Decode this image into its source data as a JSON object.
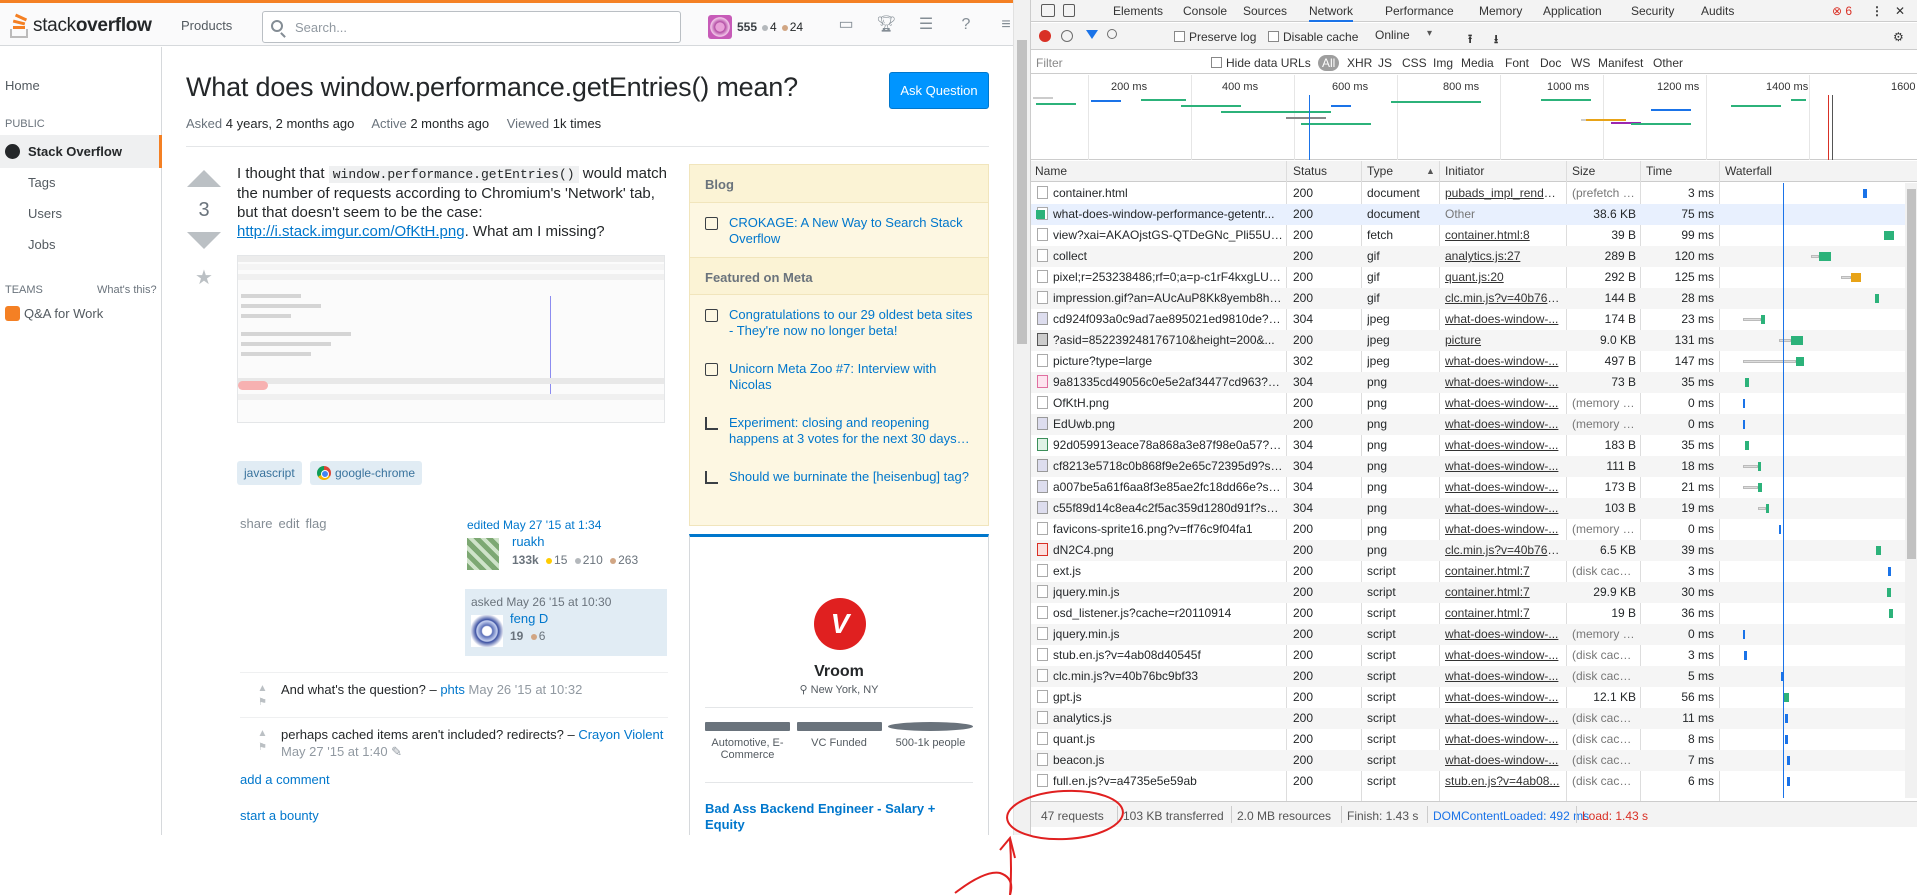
{
  "so": {
    "logo": {
      "stack": "stack",
      "overflow": "overflow"
    },
    "products": "Products",
    "search_placeholder": "Search...",
    "user": {
      "rep": "555",
      "silver": "4",
      "bronze": "24"
    },
    "nav": {
      "home": "Home",
      "public": "PUBLIC",
      "stack_overflow": "Stack Overflow",
      "tags": "Tags",
      "users": "Users",
      "jobs": "Jobs",
      "teams": "TEAMS",
      "whats_this": "What's this?",
      "qa_for_work": "Q&A for Work"
    },
    "question": {
      "title": "What does window.performance.getEntries() mean?",
      "ask_button": "Ask Question",
      "asked_label": "Asked",
      "asked_value": "4 years, 2 months ago",
      "active_label": "Active",
      "active_value": "2 months ago",
      "viewed_label": "Viewed",
      "viewed_value": "1k times",
      "votes": "3",
      "body_1": "I thought that ",
      "body_code": "window.performance.getEntries()",
      "body_2": " would match the number of requests according to Chromium's 'Network' tab, but that doesn't seem to be the case: ",
      "body_link": "http://i.stack.imgur.com/OfKtH.png",
      "body_3": ". What am I missing?",
      "tags": [
        "javascript",
        "google-chrome"
      ],
      "menu": [
        "share",
        "edit",
        "flag"
      ],
      "edited": {
        "when": "edited May 27 '15 at 1:34",
        "name": "ruakh",
        "rep": "133k",
        "gold": "15",
        "silver": "210",
        "bronze": "263"
      },
      "asked": {
        "when": "asked May 26 '15 at 10:30",
        "name": "feng D",
        "rep": "19",
        "bronze": "6"
      }
    },
    "comments": [
      {
        "text": "And what's the question? – ",
        "user": "phts",
        "date": " May 26 '15 at 10:32"
      },
      {
        "text": "perhaps cached items aren't included? redirects? – ",
        "user": "Crayon Violent",
        "date": " May 27 '15 at 1:40 ✎"
      }
    ],
    "add_comment": "add a comment",
    "start_bounty": "start a bounty",
    "sidebar": {
      "blog_heading": "Blog",
      "blog_items": [
        "CROKAGE: A New Way to Search Stack Overflow"
      ],
      "meta_heading": "Featured on Meta",
      "meta_items": [
        "Congratulations to our 29 oldest beta sites - They're now no longer beta!",
        "Unicorn Meta Zoo #7: Interview with Nicolas",
        "Experiment: closing and reopening happens at 3 votes for the next 30 days…",
        "Should we burninate the [heisenbug] tag?"
      ]
    },
    "job": {
      "logo_letter": "V",
      "company": "Vroom",
      "location": "New York, NY",
      "facts": [
        "Automotive, E-Commerce",
        "VC Funded",
        "500-1k people"
      ],
      "title": "Bad Ass Backend Engineer - Salary + Equity"
    }
  },
  "devtools": {
    "tabs": [
      "Elements",
      "Console",
      "Sources",
      "Network",
      "Performance",
      "Memory",
      "Application",
      "Security",
      "Audits"
    ],
    "active_tab": "Network",
    "error_count": "6",
    "toolbar": {
      "preserve_log": "Preserve log",
      "disable_cache": "Disable cache",
      "throttle": "Online"
    },
    "filter_placeholder": "Filter",
    "hide_data_urls": "Hide data URLs",
    "types": [
      "All",
      "XHR",
      "JS",
      "CSS",
      "Img",
      "Media",
      "Font",
      "Doc",
      "WS",
      "Manifest",
      "Other"
    ],
    "overview_ticks": [
      "200 ms",
      "400 ms",
      "600 ms",
      "800 ms",
      "1000 ms",
      "1200 ms",
      "1400 ms",
      "1600"
    ],
    "columns": [
      "Name",
      "Status",
      "Type",
      "Initiator",
      "Size",
      "Time",
      "Waterfall"
    ],
    "requests": [
      {
        "name": "container.html",
        "status": "200",
        "type": "document",
        "initiator": "pubads_impl_render...",
        "size": "(prefetch c...",
        "time": "3 ms",
        "icon": "doc"
      },
      {
        "name": "what-does-window-performance-getentr...",
        "status": "200",
        "type": "document",
        "initiator": "Other",
        "size": "38.6 KB",
        "time": "75 ms",
        "icon": "doc"
      },
      {
        "name": "view?xai=AKAOjstGS-QTDeGNc_Pli55UR...",
        "status": "200",
        "type": "fetch",
        "initiator": "container.html:8",
        "size": "39 B",
        "time": "99 ms",
        "icon": "doc"
      },
      {
        "name": "collect",
        "status": "200",
        "type": "gif",
        "initiator": "analytics.js:27",
        "size": "289 B",
        "time": "120 ms",
        "icon": "doc"
      },
      {
        "name": "pixel;r=253238486;rf=0;a=p-c1rF4kxgLUz...",
        "status": "200",
        "type": "gif",
        "initiator": "quant.js:20",
        "size": "292 B",
        "time": "125 ms",
        "icon": "doc"
      },
      {
        "name": "impression.gif?an=AUcAuP8Kk8yemb8h1...",
        "status": "200",
        "type": "gif",
        "initiator": "clc.min.js?v=40b76b...",
        "size": "144 B",
        "time": "28 ms",
        "icon": "doc"
      },
      {
        "name": "cd924f093a0c9ad7ae895021ed9810de?s...",
        "status": "304",
        "type": "jpeg",
        "initiator": "what-does-window-...",
        "size": "174 B",
        "time": "23 ms",
        "icon": "img"
      },
      {
        "name": "?asid=852239248176710&height=200&...",
        "status": "200",
        "type": "jpeg",
        "initiator": "picture",
        "size": "9.0 KB",
        "time": "131 ms",
        "icon": "dark"
      },
      {
        "name": "picture?type=large",
        "status": "302",
        "type": "jpeg",
        "initiator": "what-does-window-...",
        "size": "497 B",
        "time": "147 ms",
        "icon": "doc"
      },
      {
        "name": "9a81335cd49056c0e5e2af34477cd963?s...",
        "status": "304",
        "type": "png",
        "initiator": "what-does-window-...",
        "size": "73 B",
        "time": "35 ms",
        "icon": "pink"
      },
      {
        "name": "OfKtH.png",
        "status": "200",
        "type": "png",
        "initiator": "what-does-window-...",
        "size": "(memory c...",
        "time": "0 ms",
        "icon": "doc"
      },
      {
        "name": "EdUwb.png",
        "status": "200",
        "type": "png",
        "initiator": "what-does-window-...",
        "size": "(memory c...",
        "time": "0 ms",
        "icon": "img"
      },
      {
        "name": "92d059913eace78a868a3e87f98e0a57?s...",
        "status": "304",
        "type": "png",
        "initiator": "what-does-window-...",
        "size": "183 B",
        "time": "35 ms",
        "icon": "green"
      },
      {
        "name": "cf8213e5718c0b868f9e2e65c72395d9?s=...",
        "status": "304",
        "type": "png",
        "initiator": "what-does-window-...",
        "size": "111 B",
        "time": "18 ms",
        "icon": "img"
      },
      {
        "name": "a007be5a61f6aa8f3e85ae2fc18dd66e?s=...",
        "status": "304",
        "type": "png",
        "initiator": "what-does-window-...",
        "size": "173 B",
        "time": "21 ms",
        "icon": "img"
      },
      {
        "name": "c55f89d14c8ea4c2f5ac359d1280d91f?s=...",
        "status": "304",
        "type": "png",
        "initiator": "what-does-window-...",
        "size": "103 B",
        "time": "19 ms",
        "icon": "img"
      },
      {
        "name": "favicons-sprite16.png?v=ff76c9f04fa1",
        "status": "200",
        "type": "png",
        "initiator": "what-does-window-...",
        "size": "(memory c...",
        "time": "0 ms",
        "icon": "doc"
      },
      {
        "name": "dN2C4.png",
        "status": "200",
        "type": "png",
        "initiator": "clc.min.js?v=40b76b...",
        "size": "6.5 KB",
        "time": "39 ms",
        "icon": "red"
      },
      {
        "name": "ext.js",
        "status": "200",
        "type": "script",
        "initiator": "container.html:7",
        "size": "(disk cache)",
        "time": "3 ms",
        "icon": "doc"
      },
      {
        "name": "jquery.min.js",
        "status": "200",
        "type": "script",
        "initiator": "container.html:7",
        "size": "29.9 KB",
        "time": "30 ms",
        "icon": "doc"
      },
      {
        "name": "osd_listener.js?cache=r20110914",
        "status": "200",
        "type": "script",
        "initiator": "container.html:7",
        "size": "19 B",
        "time": "36 ms",
        "icon": "doc"
      },
      {
        "name": "jquery.min.js",
        "status": "200",
        "type": "script",
        "initiator": "what-does-window-...",
        "size": "(memory c...",
        "time": "0 ms",
        "icon": "doc"
      },
      {
        "name": "stub.en.js?v=4ab08d40545f",
        "status": "200",
        "type": "script",
        "initiator": "what-does-window-...",
        "size": "(disk cache)",
        "time": "3 ms",
        "icon": "doc"
      },
      {
        "name": "clc.min.js?v=40b76bc9bf33",
        "status": "200",
        "type": "script",
        "initiator": "what-does-window-...",
        "size": "(disk cache)",
        "time": "5 ms",
        "icon": "doc"
      },
      {
        "name": "gpt.js",
        "status": "200",
        "type": "script",
        "initiator": "what-does-window-...",
        "size": "12.1 KB",
        "time": "56 ms",
        "icon": "doc"
      },
      {
        "name": "analytics.js",
        "status": "200",
        "type": "script",
        "initiator": "what-does-window-...",
        "size": "(disk cache)",
        "time": "11 ms",
        "icon": "doc"
      },
      {
        "name": "quant.js",
        "status": "200",
        "type": "script",
        "initiator": "what-does-window-...",
        "size": "(disk cache)",
        "time": "8 ms",
        "icon": "doc"
      },
      {
        "name": "beacon.js",
        "status": "200",
        "type": "script",
        "initiator": "what-does-window-...",
        "size": "(disk cache)",
        "time": "7 ms",
        "icon": "doc"
      },
      {
        "name": "full.en.js?v=a4735e5e59ab",
        "status": "200",
        "type": "script",
        "initiator": "stub.en.js?v=4ab08...",
        "size": "(disk cache)",
        "time": "6 ms",
        "icon": "doc"
      }
    ],
    "status_bar": {
      "requests": "47 requests",
      "transferred": "103 KB transferred",
      "resources": "2.0 MB resources",
      "finish": "Finish: 1.43 s",
      "dom_content_loaded": "DOMContentLoaded: 492 ms",
      "load": "Load: 1.43 s"
    }
  },
  "colors": {
    "so_orange": "#f48024",
    "so_blue": "#0077cc",
    "dt_blue": "#1a73e8",
    "dt_red": "#d93025",
    "annotation_red": "#e02020"
  }
}
